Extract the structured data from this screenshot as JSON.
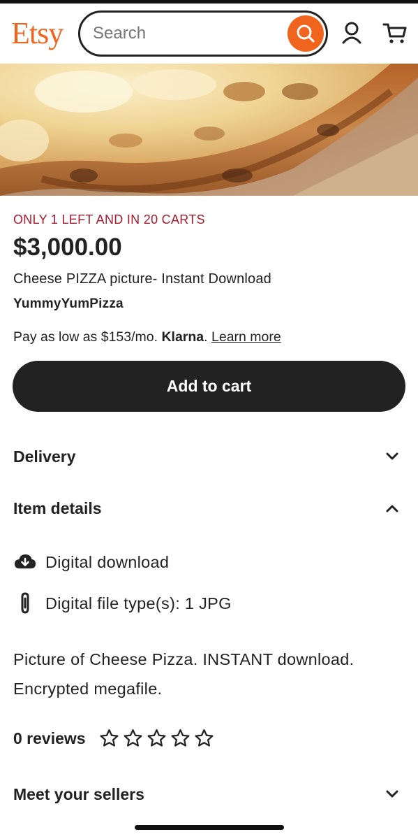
{
  "header": {
    "logo": "Etsy",
    "search_placeholder": "Search",
    "brand_color": "#f1641e",
    "icons": [
      "search-icon",
      "account-icon",
      "cart-icon"
    ]
  },
  "hero": {
    "subject": "cheese-pizza-photo"
  },
  "listing": {
    "scarcity": "ONLY 1 LEFT AND IN 20 CARTS",
    "scarcity_color": "#a61a2e",
    "price": "$3,000.00",
    "title": "Cheese PIZZA picture- Instant Download",
    "shop_name": "YummyYumPizza",
    "klarna_prefix": "Pay as low as $153/mo. ",
    "klarna_brand": "Klarna",
    "klarna_period": ".",
    "klarna_link": "Learn more",
    "add_to_cart": "Add to cart"
  },
  "sections": {
    "delivery": {
      "label": "Delivery",
      "expanded": false
    },
    "item_details": {
      "label": "Item details",
      "expanded": true,
      "rows": [
        {
          "icon": "cloud-download-icon",
          "text": "Digital download"
        },
        {
          "icon": "paperclip-icon",
          "text": "Digital file type(s): 1 JPG"
        }
      ],
      "description": "Picture of Cheese Pizza. INSTANT download. Encrypted megafile."
    },
    "reviews": {
      "label": "0 reviews",
      "rating": 0,
      "max_rating": 5
    },
    "sellers": {
      "label": "Meet your sellers",
      "expanded": false
    }
  }
}
